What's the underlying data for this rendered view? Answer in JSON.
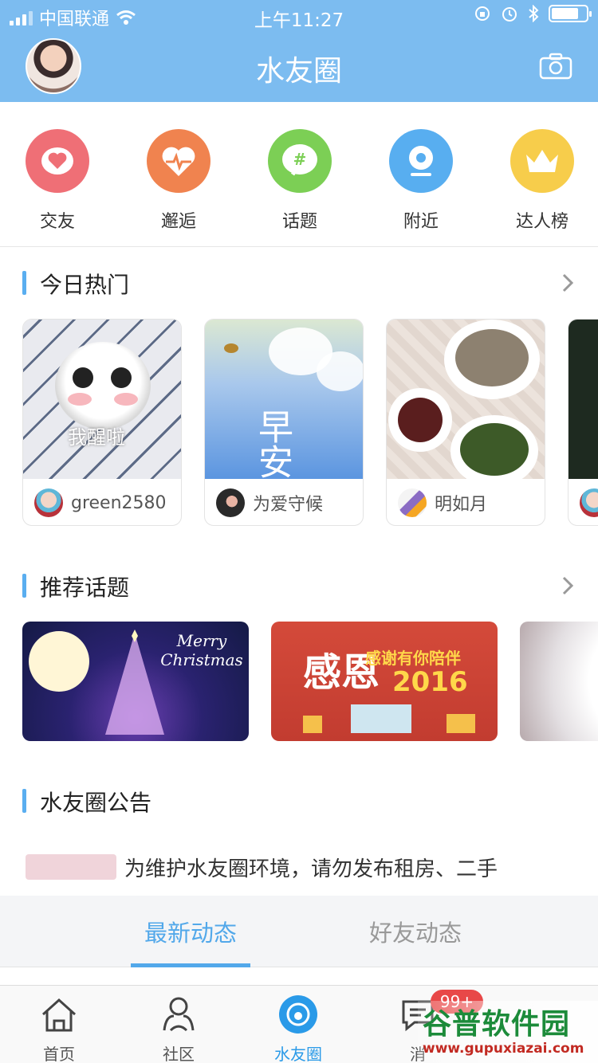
{
  "status_bar": {
    "carrier": "中国联通",
    "time": "上午11:27",
    "battery_level_percent": 80
  },
  "header": {
    "title": "水友圈",
    "avatar_icon": "user-avatar",
    "camera_icon": "camera-icon"
  },
  "quick_entries": [
    {
      "label": "交友",
      "icon": "heart-icon",
      "color": "#ef6f76"
    },
    {
      "label": "邂逅",
      "icon": "heartbeat-icon",
      "color": "#f0834f"
    },
    {
      "label": "话题",
      "icon": "hashtag-icon",
      "color": "#7ccf55"
    },
    {
      "label": "附近",
      "icon": "location-icon",
      "color": "#58aef0"
    },
    {
      "label": "达人榜",
      "icon": "crown-icon",
      "color": "#f7cd4b"
    }
  ],
  "hot_today": {
    "title": "今日热门",
    "cards": [
      {
        "username": "green2580",
        "image_caption": "我醒啦"
      },
      {
        "username": "为爱守候",
        "image_caption": "早安"
      },
      {
        "username": "明如月",
        "image_caption": ""
      }
    ]
  },
  "recommended_topics": {
    "title": "推荐话题",
    "banners": [
      {
        "text": "Merry Christmas"
      },
      {
        "text_main": "感恩",
        "text_sub": "感谢有你陪伴",
        "year": "2016"
      },
      {
        "text": ""
      }
    ]
  },
  "notice": {
    "title": "水友圈公告",
    "text": "为维护水友圈环境，请勿发布租房、二手"
  },
  "feed_tabs": [
    {
      "label": "最新动态",
      "active": true
    },
    {
      "label": "好友动态",
      "active": false
    }
  ],
  "bottom_nav": {
    "items": [
      {
        "label": "首页",
        "icon": "home-icon",
        "active": false
      },
      {
        "label": "社区",
        "icon": "community-icon",
        "active": false
      },
      {
        "label": "水友圈",
        "icon": "circle-icon",
        "active": true
      },
      {
        "label": "消",
        "icon": "message-icon",
        "active": false
      }
    ],
    "badge": "99+"
  },
  "watermark": {
    "main": "谷普软件园",
    "url": "www.gupuxiazai.com"
  },
  "colors": {
    "header_bg": "#7cbcf0",
    "accent": "#52a8ea",
    "badge": "#e84848"
  }
}
